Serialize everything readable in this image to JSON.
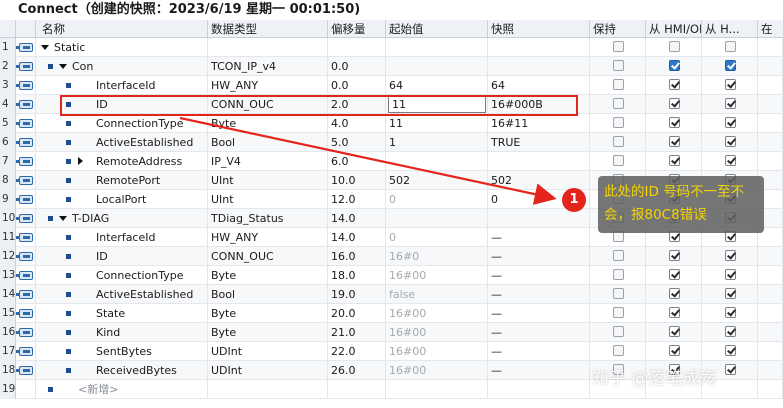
{
  "window": {
    "title": "Connect（创建的快照：2023/6/19 星期一 00:01:50)"
  },
  "columns": {
    "name": "名称",
    "type": "数据类型",
    "offset": "偏移量",
    "start": "起始值",
    "snapshot": "快照",
    "retain": "保持",
    "hmi1": "从 HMI/OPC...",
    "hmi2": "从 H...",
    "extra": "在"
  },
  "rows": [
    {
      "num": "1",
      "name": "Static",
      "type": "",
      "offset": "",
      "start": "",
      "snapshot": "",
      "level": 0,
      "marker": "down",
      "retain": false,
      "hmi1": false,
      "hmi2": false,
      "dim_start": false
    },
    {
      "num": "2",
      "name": "Con",
      "type": "TCON_IP_v4",
      "offset": "0.0",
      "start": "",
      "snapshot": "",
      "level": 1,
      "marker": "down",
      "retain": false,
      "hmi1": true,
      "hmi2": true,
      "dim_start": false,
      "hl": true
    },
    {
      "num": "3",
      "name": "InterfaceId",
      "type": "HW_ANY",
      "offset": "0.0",
      "start": "64",
      "snapshot": "64",
      "level": 2,
      "marker": "",
      "retain": false,
      "hmi1": true,
      "hmi2": true,
      "dim_start": false
    },
    {
      "num": "4",
      "name": "ID",
      "type": "CONN_OUC",
      "offset": "2.0",
      "start": "11",
      "snapshot": "16#000B",
      "level": 2,
      "marker": "",
      "retain": false,
      "hmi1": true,
      "hmi2": true,
      "dim_start": false,
      "editing": true
    },
    {
      "num": "5",
      "name": "ConnectionType",
      "type": "Byte",
      "offset": "4.0",
      "start": "11",
      "snapshot": "16#11",
      "level": 2,
      "marker": "",
      "retain": false,
      "hmi1": true,
      "hmi2": true,
      "dim_start": false
    },
    {
      "num": "6",
      "name": "ActiveEstablished",
      "type": "Bool",
      "offset": "5.0",
      "start": "1",
      "snapshot": "TRUE",
      "level": 2,
      "marker": "",
      "retain": false,
      "hmi1": true,
      "hmi2": true,
      "dim_start": false
    },
    {
      "num": "7",
      "name": "RemoteAddress",
      "type": "IP_V4",
      "offset": "6.0",
      "start": "",
      "snapshot": "",
      "level": 2,
      "marker": "right",
      "retain": false,
      "hmi1": true,
      "hmi2": true,
      "dim_start": false
    },
    {
      "num": "8",
      "name": "RemotePort",
      "type": "UInt",
      "offset": "10.0",
      "start": "502",
      "snapshot": "502",
      "level": 2,
      "marker": "",
      "retain": false,
      "hmi1": true,
      "hmi2": true,
      "dim_start": false
    },
    {
      "num": "9",
      "name": "LocalPort",
      "type": "UInt",
      "offset": "12.0",
      "start": "0",
      "snapshot": "0",
      "level": 2,
      "marker": "",
      "retain": false,
      "hmi1": true,
      "hmi2": true,
      "dim_start": true
    },
    {
      "num": "10",
      "name": "T-DIAG",
      "type": "TDiag_Status",
      "offset": "14.0",
      "start": "",
      "snapshot": "",
      "level": 1,
      "marker": "down",
      "retain": false,
      "hmi1": true,
      "hmi2": true,
      "dim_start": false
    },
    {
      "num": "11",
      "name": "InterfaceId",
      "type": "HW_ANY",
      "offset": "14.0",
      "start": "0",
      "snapshot": "—",
      "level": 2,
      "marker": "",
      "retain": false,
      "hmi1": true,
      "hmi2": true,
      "dim_start": true
    },
    {
      "num": "12",
      "name": "ID",
      "type": "CONN_OUC",
      "offset": "16.0",
      "start": "16#0",
      "snapshot": "—",
      "level": 2,
      "marker": "",
      "retain": false,
      "hmi1": true,
      "hmi2": true,
      "dim_start": true
    },
    {
      "num": "13",
      "name": "ConnectionType",
      "type": "Byte",
      "offset": "18.0",
      "start": "16#00",
      "snapshot": "—",
      "level": 2,
      "marker": "",
      "retain": false,
      "hmi1": true,
      "hmi2": true,
      "dim_start": true
    },
    {
      "num": "14",
      "name": "ActiveEstablished",
      "type": "Bool",
      "offset": "19.0",
      "start": "false",
      "snapshot": "—",
      "level": 2,
      "marker": "",
      "retain": false,
      "hmi1": true,
      "hmi2": true,
      "dim_start": true
    },
    {
      "num": "15",
      "name": "State",
      "type": "Byte",
      "offset": "20.0",
      "start": "16#00",
      "snapshot": "—",
      "level": 2,
      "marker": "",
      "retain": false,
      "hmi1": true,
      "hmi2": true,
      "dim_start": true
    },
    {
      "num": "16",
      "name": "Kind",
      "type": "Byte",
      "offset": "21.0",
      "start": "16#00",
      "snapshot": "—",
      "level": 2,
      "marker": "",
      "retain": false,
      "hmi1": true,
      "hmi2": true,
      "dim_start": true
    },
    {
      "num": "17",
      "name": "SentBytes",
      "type": "UDInt",
      "offset": "22.0",
      "start": "16#00",
      "snapshot": "—",
      "level": 2,
      "marker": "",
      "retain": false,
      "hmi1": true,
      "hmi2": true,
      "dim_start": true
    },
    {
      "num": "18",
      "name": "ReceivedBytes",
      "type": "UDInt",
      "offset": "26.0",
      "start": "16#00",
      "snapshot": "—",
      "level": 2,
      "marker": "",
      "retain": false,
      "hmi1": true,
      "hmi2": true,
      "dim_start": true
    },
    {
      "num": "19",
      "name": "<新增>",
      "type": "",
      "offset": "",
      "start": "",
      "snapshot": "",
      "level": 1,
      "marker": "",
      "retain": null,
      "hmi1": null,
      "hmi2": null,
      "dim_start": false,
      "placeholder": true
    }
  ],
  "annotation": {
    "badge": "1",
    "text": "此处的ID 号码不一至不会，报80C8错误"
  },
  "watermark": "知乎 @落笔成殇",
  "colors": {
    "highlight": "#e4251b",
    "callout_text": "#f4d400",
    "checkbox_on": "#2f78c8"
  },
  "icons": {
    "row_icon": "db-member-icon",
    "checkbox": "check-icon"
  }
}
